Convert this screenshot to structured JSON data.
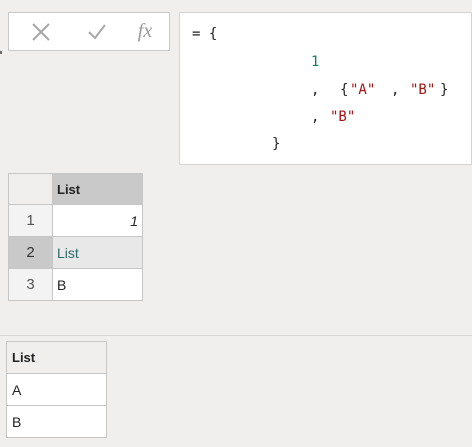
{
  "formula_bar": {
    "fx_label": "fx",
    "code_lines": [
      "= {",
      "1",
      ",",
      "{",
      "\"A\"",
      ",",
      "\"B\"",
      "}",
      ",",
      "\"B\"",
      "}"
    ]
  },
  "result_grid": {
    "column_header": "List",
    "rows": [
      {
        "index": "1",
        "value": "1"
      },
      {
        "index": "2",
        "value": "List"
      },
      {
        "index": "3",
        "value": "B"
      }
    ]
  },
  "preview_table": {
    "header": "List",
    "rows": [
      "A",
      "B"
    ]
  },
  "colors": {
    "number": "#098658",
    "string": "#a31515",
    "selected_row": "#c9c9c9"
  }
}
